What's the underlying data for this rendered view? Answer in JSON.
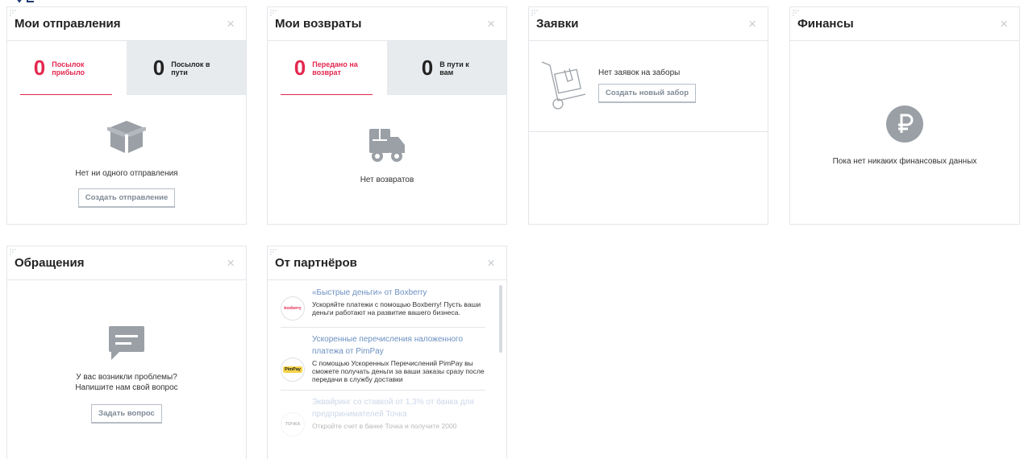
{
  "shipments": {
    "title": "Мои отправления",
    "arrived_count": "0",
    "arrived_label": "Посылок прибыло",
    "transit_count": "0",
    "transit_label": "Посылок в пути",
    "empty_text": "Нет ни одного отправления",
    "create_button": "Создать отправление"
  },
  "returns": {
    "title": "Мои возвраты",
    "sent_count": "0",
    "sent_label": "Передано на возврат",
    "transit_count": "0",
    "transit_label": "В пути к вам",
    "empty_text": "Нет возвратов"
  },
  "requests": {
    "title": "Заявки",
    "empty_text": "Нет заявок на заборы",
    "create_button": "Создать новый забор"
  },
  "finance": {
    "title": "Финансы",
    "empty_text": "Пока нет никаких финансовых данных"
  },
  "support": {
    "title": "Обращения",
    "text_line1": "У вас возникли проблемы?",
    "text_line2": "Напишите нам свой вопрос",
    "ask_button": "Задать вопрос"
  },
  "partners": {
    "title": "От партнёров",
    "items": [
      {
        "title": "«Быстрые деньги» от Boxberry",
        "desc": "Ускоряйте платежи с помощью Boxberry! Пусть ваши деньги работают на развитие вашего бизнеса.",
        "logo_text": "boxberry"
      },
      {
        "title": "Ускоренные перечисления наложенного платежа от PimPay",
        "desc": "С помощью Ускоренных Перечислений PimPay вы сможете получать деньги за ваши заказы сразу после передачи в службу доставки",
        "logo_text": "PimPay"
      },
      {
        "title": "Эквайринг со ставкой от 1,3% от банка для предпринимателей Точка",
        "desc": "Откройте счет в банке Точка и получите 2000",
        "logo_text": "ТОЧКА"
      }
    ]
  },
  "colors": {
    "accent": "#e3284f",
    "link": "#6b90c1",
    "icon_gray": "#9aa0a6"
  },
  "close_symbol": "×"
}
